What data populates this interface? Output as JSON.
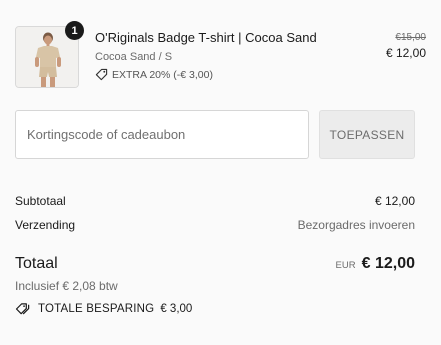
{
  "cart": {
    "item": {
      "quantity": "1",
      "title": "O'Riginals Badge T-shirt | Cocoa Sand",
      "variant": "Cocoa Sand / S",
      "discount_label": "EXTRA 20% (-€ 3,00)",
      "old_price": "€15,00",
      "price": "€ 12,00",
      "discount_icon": "tag-icon"
    }
  },
  "discount": {
    "placeholder": "Kortingscode of cadeaubon",
    "apply_label": "TOEPASSEN"
  },
  "summary": {
    "subtotal_label": "Subtotaal",
    "subtotal_value": "€ 12,00",
    "shipping_label": "Verzending",
    "shipping_value": "Bezorgadres invoeren",
    "total_label": "Totaal",
    "currency": "EUR",
    "total_value": "€ 12,00",
    "tax_note": "Inclusief € 2,08 btw",
    "savings_label": "TOTALE BESPARING",
    "savings_value": "€ 3,00",
    "savings_icon": "tags-icon"
  }
}
